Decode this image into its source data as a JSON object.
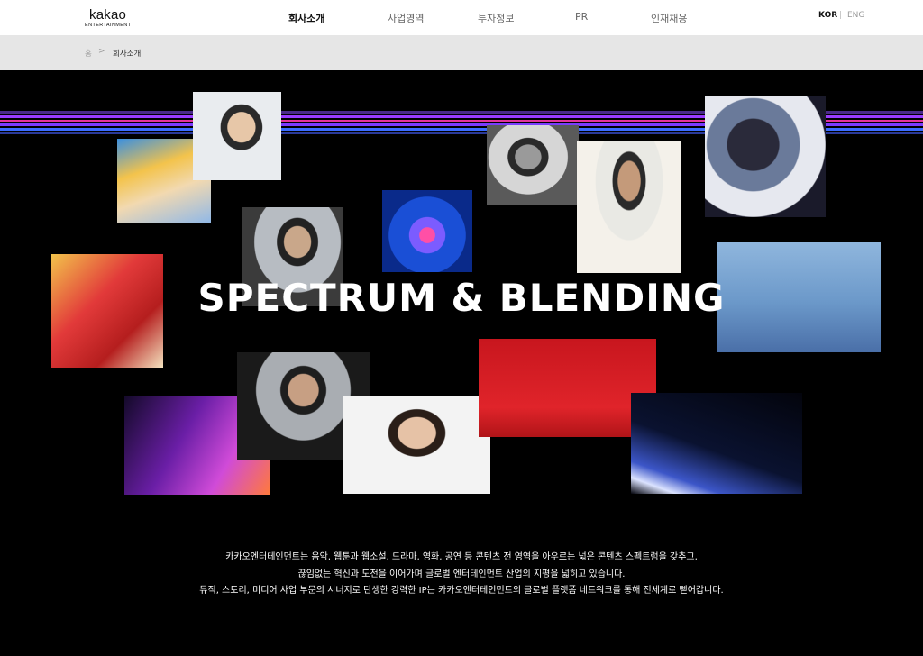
{
  "header": {
    "logo": {
      "word": "kakao",
      "sub": "ENTERTAINMENT"
    },
    "nav": [
      {
        "label": "회사소개",
        "active": true
      },
      {
        "label": "사업영역",
        "active": false
      },
      {
        "label": "투자정보",
        "active": false
      },
      {
        "label": "PR",
        "active": false
      },
      {
        "label": "인재채용",
        "active": false
      }
    ],
    "lang": {
      "kor": "KOR",
      "separator": "|",
      "eng": "ENG"
    }
  },
  "breadcrumb": {
    "home": "홈",
    "separator": ">",
    "current": "회사소개"
  },
  "hero": {
    "headline": "SPECTRUM & BLENDING",
    "description": [
      "카카오엔터테인먼트는 음악, 웹툰과 웹소설, 드라마, 영화, 공연 등 콘텐츠 전 영역을 아우르는 넓은 콘텐츠 스펙트럼을 갖추고,",
      "끊임없는 혁신과 도전을 이어가며 글로벌 엔터테인먼트 산업의 지평을 넓히고 있습니다.",
      "뮤직, 스토리, 미디어 사업 부문의 시너지로 탄생한 강력한 IP는 카카오엔터테인먼트의 글로벌 플랫폼 네트워크를 통해 전세계로 뻗어갑니다."
    ]
  },
  "colors": {
    "accent_purple": "#8a3cff",
    "accent_magenta": "#e2329c",
    "accent_blue": "#3a6cff",
    "hero_bg": "#000000"
  }
}
